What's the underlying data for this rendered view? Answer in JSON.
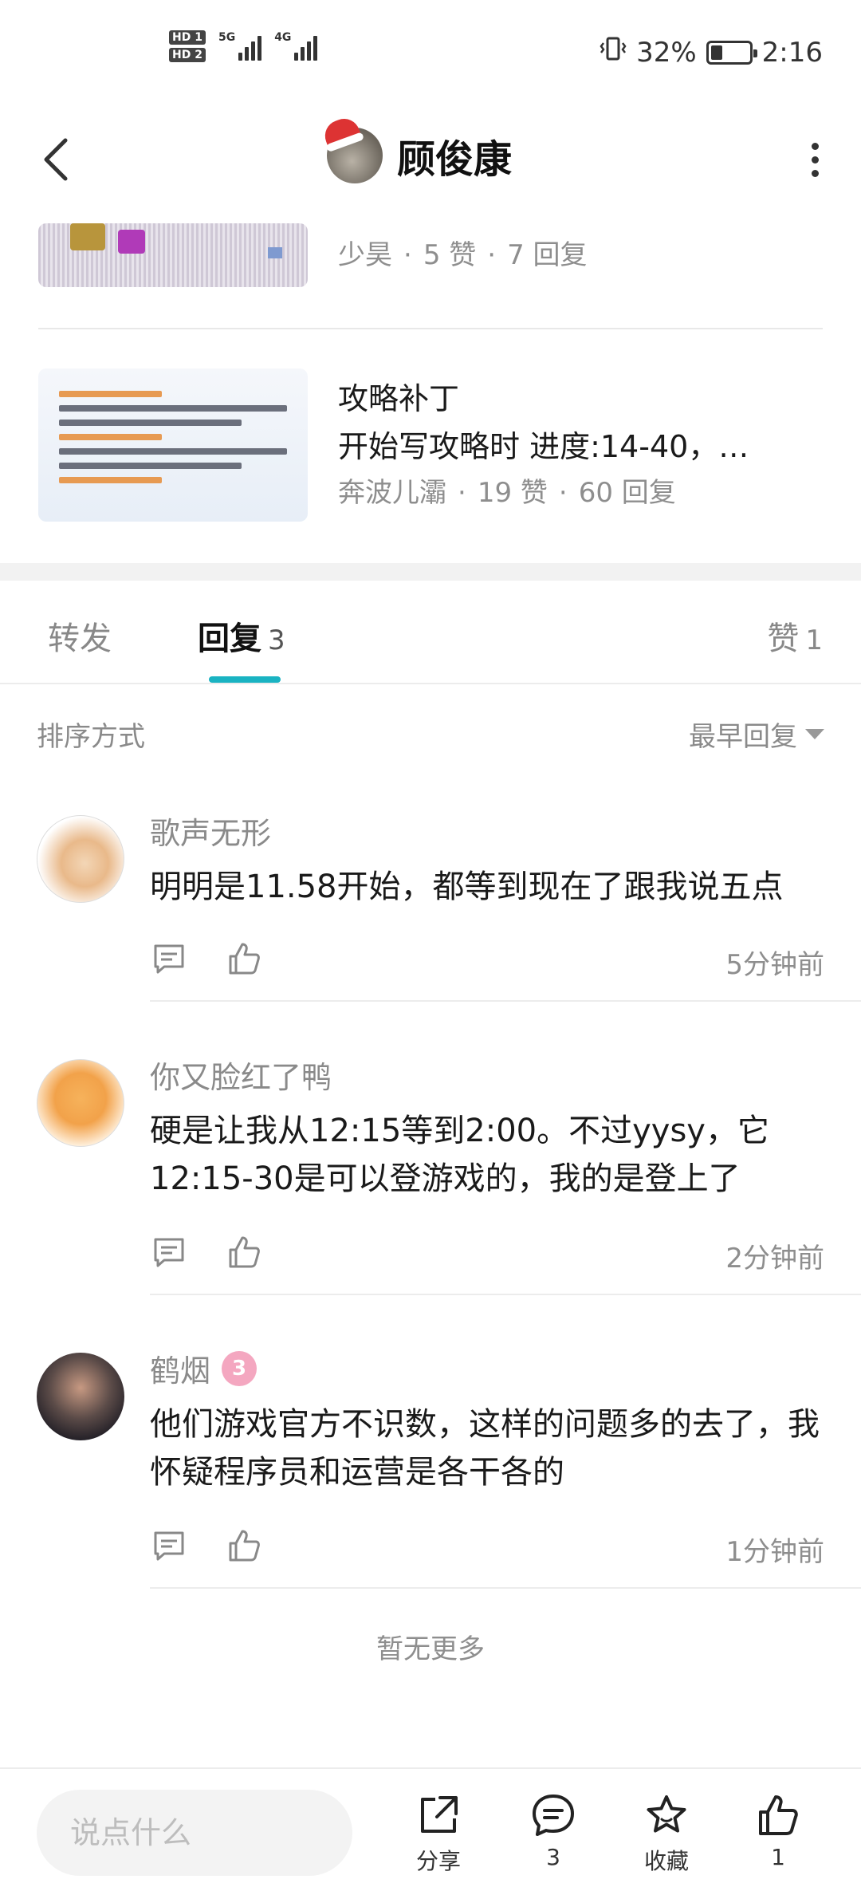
{
  "status_bar": {
    "sim1": "HD 1",
    "sim2": "HD 2",
    "net1": "5G",
    "net2": "4G",
    "battery": "32%",
    "time": "2:16",
    "battery_level": 0.32
  },
  "header": {
    "title": "顾俊康"
  },
  "related_posts": [
    {
      "author": "少昊",
      "likes": "5 赞",
      "replies": "7 回复"
    },
    {
      "title": "攻略补丁",
      "desc": "开始写攻略时    进度:14-40，…",
      "author": "奔波儿灞",
      "likes": "19 赞",
      "replies": "60 回复"
    }
  ],
  "tabs": {
    "forward": "转发",
    "replies": "回复",
    "replies_count": "3",
    "likes": "赞",
    "likes_count": "1"
  },
  "sort": {
    "label": "排序方式",
    "value": "最早回复"
  },
  "comments": [
    {
      "name": "歌声无形",
      "text": "明明是11.58开始，都等到现在了跟我说五点",
      "time": "5分钟前"
    },
    {
      "name": "你又脸红了鸭",
      "text": "硬是让我从12:15等到2:00。不过yysy，它12:15-30是可以登游戏的，我的是登上了",
      "time": "2分钟前"
    },
    {
      "name": "鹤烟",
      "badge": "3",
      "text": "他们游戏官方不识数，这样的问题多的去了，我怀疑程序员和运营是各干各的",
      "time": "1分钟前"
    }
  ],
  "no_more": "暂无更多",
  "bottom_bar": {
    "input_placeholder": "说点什么",
    "share": "分享",
    "comments_count": "3",
    "favorite": "收藏",
    "likes_count": "1"
  },
  "colors": {
    "accent": "#1ab3c2",
    "badge": "#f4a7c0"
  }
}
